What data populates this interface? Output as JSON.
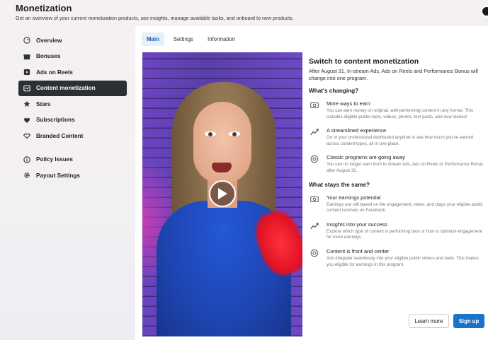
{
  "header": {
    "title": "Monetization",
    "subtitle": "Get an overview of your current monetization products, see insights, manage available tasks, and onboard to new products."
  },
  "sidebar": {
    "items": [
      {
        "label": "Overview",
        "icon": "gauge-icon"
      },
      {
        "label": "Bonuses",
        "icon": "gift-icon"
      },
      {
        "label": "Ads on Reels",
        "icon": "reels-icon"
      },
      {
        "label": "Content monetization",
        "icon": "content-icon",
        "active": true
      },
      {
        "label": "Stars",
        "icon": "star-icon"
      },
      {
        "label": "Subscriptions",
        "icon": "heart-icon"
      },
      {
        "label": "Branded Content",
        "icon": "handshake-icon"
      },
      {
        "label": "Policy Issues",
        "icon": "info-icon"
      },
      {
        "label": "Payout Settings",
        "icon": "gear-icon"
      }
    ]
  },
  "tabs": [
    "Main",
    "Settings",
    "Information"
  ],
  "content": {
    "title": "Switch to content monetization",
    "intro": "After August 31, In-stream Ads, Ads on Reels and Performance Bonus will change into one program.",
    "changing_heading": "What's changing?",
    "changing": [
      {
        "title": "More ways to earn",
        "desc": "You can earn money on original, well-performing content in any format. This includes eligible public reels, videos, photos, text posts, and now stories!",
        "icon": "money-icon"
      },
      {
        "title": "A streamlined experience",
        "desc": "Go to your professional dashboard anytime to see how much you've earned across content types, all in one place.",
        "icon": "trend-icon"
      },
      {
        "title": "Classic programs are going away",
        "desc": "You can no longer earn from In-stream Ads, Ads on Reels or Performance Bonus after August 31.",
        "icon": "target-icon"
      }
    ],
    "same_heading": "What stays the same?",
    "same": [
      {
        "title": "Your earnings potential",
        "desc": "Earnings are still based on the engagement, views, and plays your eligible public content receives on Facebook.",
        "icon": "money-icon"
      },
      {
        "title": "Insights into your success",
        "desc": "Explore which type of content is performing best or how to optimize engagement for more earnings.",
        "icon": "trend-icon"
      },
      {
        "title": "Content is front and center",
        "desc": "Ads integrate seamlessly into your eligible public videos and reels. This makes you eligible for earnings in this program.",
        "icon": "target-icon"
      }
    ]
  },
  "buttons": {
    "learn_more": "Learn more",
    "sign_up": "Sign up"
  },
  "colors": {
    "accent": "#1b72c9",
    "active_nav": "#2b3035"
  }
}
